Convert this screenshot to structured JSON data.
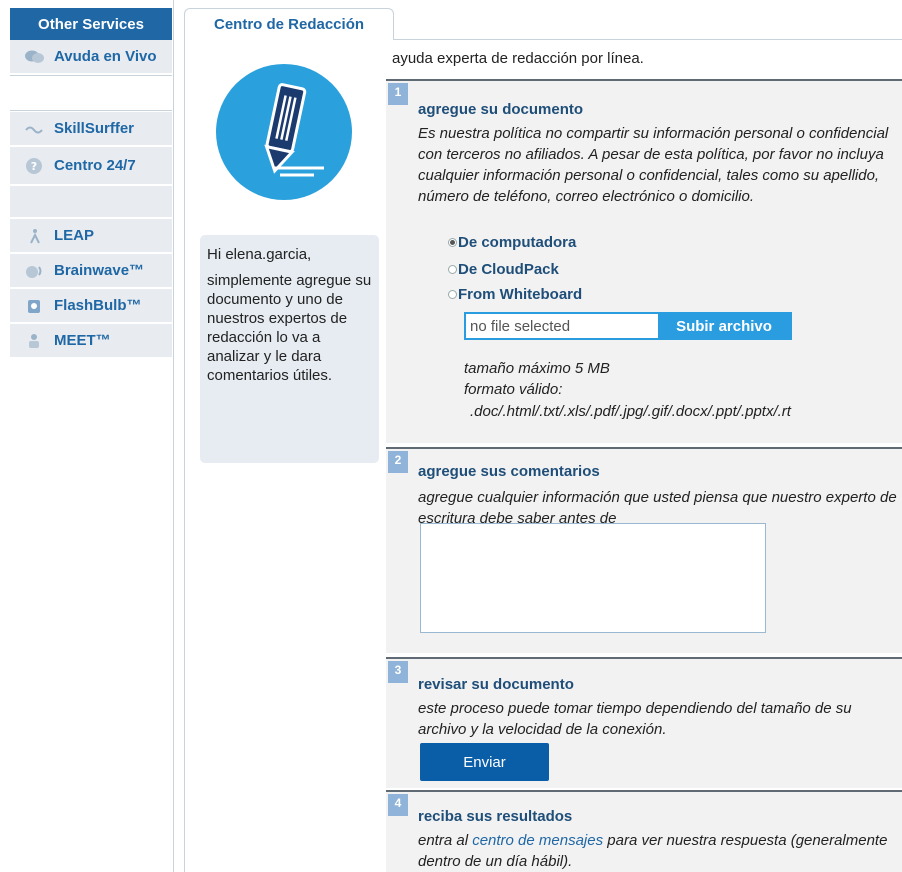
{
  "sidebar": {
    "header": "Other Services",
    "items": [
      {
        "label": "Avuda en Vivo",
        "icon": "chat-bubbles-icon"
      },
      {
        "label": "SkillSurffer",
        "icon": "wave-icon"
      },
      {
        "label": "Centro 24/7",
        "icon": "question-icon"
      },
      {
        "label": "LEAP",
        "icon": "leap-icon"
      },
      {
        "label": "Brainwave™",
        "icon": "brainwave-icon"
      },
      {
        "label": "FlashBulb™",
        "icon": "flashbulb-icon"
      },
      {
        "label": "MEET™",
        "icon": "meet-icon"
      }
    ]
  },
  "tab": {
    "label": "Centro de Redacción"
  },
  "greeting": {
    "line1": "Hi elena.garcia,",
    "line2": "simplemente agregue su documento y uno de nuestros expertos de redacción lo va a analizar y le dara comentarios útiles."
  },
  "intro": "ayuda experta de redacción por línea.",
  "steps": [
    {
      "num": "1",
      "title": "agregue su documento",
      "text": "Es nuestra política no compartir su información personal o confidencial con terceros no afiliados. A pesar de esta política, por favor no incluya cualquier información personal o confidencial, tales como su apellido, número de teléfono, correo electrónico o domicilio.",
      "options": [
        "De computadora",
        "De CloudPack",
        "From Whiteboard"
      ],
      "selected_option": "De computadora",
      "file_placeholder": "no file selected",
      "upload_label": "Subir archivo",
      "max_size": "tamaño máximo 5 MB",
      "format_label": "formato válido:",
      "formats": ".doc/.html/.txt/.xls/.pdf/.jpg/.gif/.docx/.ppt/.pptx/.rt"
    },
    {
      "num": "2",
      "title": "agregue sus comentarios",
      "text": "agregue cualquier información que usted piensa que nuestro experto de escritura debe saber antes de"
    },
    {
      "num": "3",
      "title": "revisar su documento",
      "text": "este proceso puede tomar tiempo dependiendo del tamaño de su archivo y la velocidad de la conexión.",
      "button": "Enviar"
    },
    {
      "num": "4",
      "title": "reciba sus resultados",
      "text_before": "entra al ",
      "link": "centro de mensajes",
      "text_after": " para ver nuestra respuesta (generalmente dentro de un día hábil)."
    }
  ],
  "colors": {
    "brand": "#1f67a5",
    "accent": "#2a9de0",
    "step_badge": "#8fb3d9",
    "button": "#0a5ea8"
  }
}
